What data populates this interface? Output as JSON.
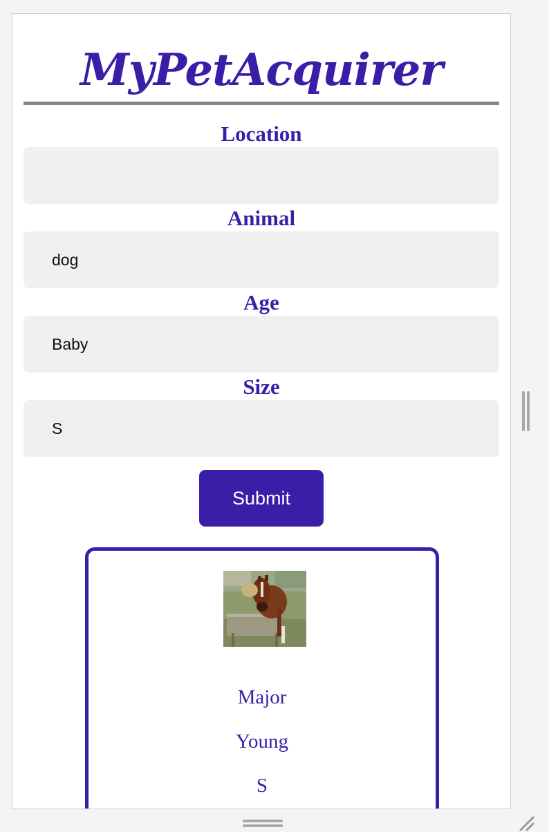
{
  "app": {
    "title": "MyPetAcquirer"
  },
  "form": {
    "location": {
      "label": "Location",
      "value": ""
    },
    "animal": {
      "label": "Animal",
      "value": "dog"
    },
    "age": {
      "label": "Age",
      "value": "Baby"
    },
    "size": {
      "label": "Size",
      "value": "S"
    },
    "submit_label": "Submit"
  },
  "result": {
    "image_icon": "horse-photo",
    "name": "Major",
    "age": "Young",
    "size": "S"
  },
  "colors": {
    "accent": "#3a1ea8",
    "field_bg": "#f0f0f0",
    "rule": "#868686"
  }
}
